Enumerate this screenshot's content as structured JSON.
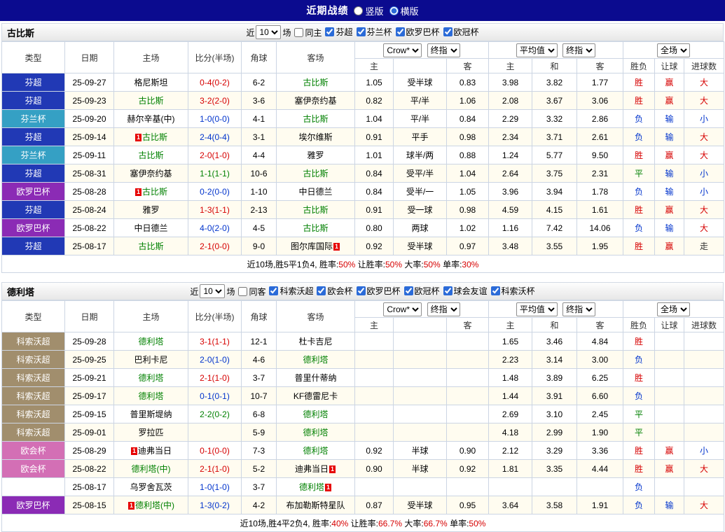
{
  "topbar": {
    "title": "近期战绩",
    "radio_vertical": "竖版",
    "radio_horizontal": "横版",
    "selected": "横版"
  },
  "colors": {
    "league": {
      "芬超": "#2139b5",
      "芬兰杯": "#35a0c4",
      "欧罗巴杯": "#8b2bb5",
      "科索沃超": "#a18e6d",
      "欧会杯": "#d36fb5"
    },
    "result": {
      "胜": "#d60000",
      "平": "#008000",
      "负": "#0033cc",
      "赢": "#d60000",
      "输": "#0033cc",
      "走": "#333333",
      "大": "#d60000",
      "小": "#0033cc"
    },
    "score": {
      "win": "#d60000",
      "draw": "#008000",
      "loss": "#0033cc"
    },
    "focal_team": "#008000",
    "summary_value": "#d60000"
  },
  "sections": [
    {
      "team": "古比斯",
      "filters": {
        "near": "近",
        "count": "10",
        "games": "场",
        "same": "同主",
        "same_checked": false,
        "leagues": [
          "芬超",
          "芬兰杯",
          "欧罗巴杯",
          "欧冠杯"
        ]
      },
      "head": {
        "type": "类型",
        "date": "日期",
        "home": "主场",
        "score": "比分(半场)",
        "corner": "角球",
        "away": "客场",
        "asia1": "Crow*",
        "asia2": "终指",
        "euro1": "平均值",
        "euro2": "终指",
        "scope": "全场",
        "h": "主",
        "a": "客",
        "d": "和",
        "res": "胜负",
        "let": "让球",
        "goal": "进球数"
      },
      "rows": [
        {
          "type": "芬超",
          "date": "25-09-27",
          "home": "格尼斯坦",
          "home_focal": false,
          "home_rc": "",
          "score": "0-4(0-2)",
          "outcome": "win",
          "corner": "6-2",
          "away": "古比斯",
          "away_focal": true,
          "away_rc": "",
          "ah": "1.05",
          "line": "受半球",
          "aa": "0.83",
          "eh": "3.98",
          "ed": "3.82",
          "ea": "1.77",
          "res": "胜",
          "let": "赢",
          "goal": "大"
        },
        {
          "type": "芬超",
          "date": "25-09-23",
          "home": "古比斯",
          "home_focal": true,
          "home_rc": "",
          "score": "3-2(2-0)",
          "outcome": "win",
          "corner": "3-6",
          "away": "塞伊奈约基",
          "away_focal": false,
          "away_rc": "",
          "ah": "0.82",
          "line": "平/半",
          "aa": "1.06",
          "eh": "2.08",
          "ed": "3.67",
          "ea": "3.06",
          "res": "胜",
          "let": "赢",
          "goal": "大"
        },
        {
          "type": "芬兰杯",
          "date": "25-09-20",
          "home": "赫尔辛基(中)",
          "home_focal": false,
          "home_rc": "",
          "score": "1-0(0-0)",
          "outcome": "loss",
          "corner": "4-1",
          "away": "古比斯",
          "away_focal": true,
          "away_rc": "",
          "ah": "1.04",
          "line": "平/半",
          "aa": "0.84",
          "eh": "2.29",
          "ed": "3.32",
          "ea": "2.86",
          "res": "负",
          "let": "输",
          "goal": "小"
        },
        {
          "type": "芬超",
          "date": "25-09-14",
          "home": "古比斯",
          "home_focal": true,
          "home_rc": "before",
          "score": "2-4(0-4)",
          "outcome": "loss",
          "corner": "3-1",
          "away": "埃尔维斯",
          "away_focal": false,
          "away_rc": "",
          "ah": "0.91",
          "line": "平手",
          "aa": "0.98",
          "eh": "2.34",
          "ed": "3.71",
          "ea": "2.61",
          "res": "负",
          "let": "输",
          "goal": "大"
        },
        {
          "type": "芬兰杯",
          "date": "25-09-11",
          "home": "古比斯",
          "home_focal": true,
          "home_rc": "",
          "score": "2-0(1-0)",
          "outcome": "win",
          "corner": "4-4",
          "away": "雅罗",
          "away_focal": false,
          "away_rc": "",
          "ah": "1.01",
          "line": "球半/两",
          "aa": "0.88",
          "eh": "1.24",
          "ed": "5.77",
          "ea": "9.50",
          "res": "胜",
          "let": "赢",
          "goal": "大"
        },
        {
          "type": "芬超",
          "date": "25-08-31",
          "home": "塞伊奈约基",
          "home_focal": false,
          "home_rc": "",
          "score": "1-1(1-1)",
          "outcome": "draw",
          "corner": "10-6",
          "away": "古比斯",
          "away_focal": true,
          "away_rc": "",
          "ah": "0.84",
          "line": "受平/半",
          "aa": "1.04",
          "eh": "2.64",
          "ed": "3.75",
          "ea": "2.31",
          "res": "平",
          "let": "输",
          "goal": "小"
        },
        {
          "type": "欧罗巴杯",
          "date": "25-08-28",
          "home": "古比斯",
          "home_focal": true,
          "home_rc": "before",
          "score": "0-2(0-0)",
          "outcome": "loss",
          "corner": "1-10",
          "away": "中日德兰",
          "away_focal": false,
          "away_rc": "",
          "ah": "0.84",
          "line": "受半/一",
          "aa": "1.05",
          "eh": "3.96",
          "ed": "3.94",
          "ea": "1.78",
          "res": "负",
          "let": "输",
          "goal": "小"
        },
        {
          "type": "芬超",
          "date": "25-08-24",
          "home": "雅罗",
          "home_focal": false,
          "home_rc": "",
          "score": "1-3(1-1)",
          "outcome": "win",
          "corner": "2-13",
          "away": "古比斯",
          "away_focal": true,
          "away_rc": "",
          "ah": "0.91",
          "line": "受一球",
          "aa": "0.98",
          "eh": "4.59",
          "ed": "4.15",
          "ea": "1.61",
          "res": "胜",
          "let": "赢",
          "goal": "大"
        },
        {
          "type": "欧罗巴杯",
          "date": "25-08-22",
          "home": "中日德兰",
          "home_focal": false,
          "home_rc": "",
          "score": "4-0(2-0)",
          "outcome": "loss",
          "corner": "4-5",
          "away": "古比斯",
          "away_focal": true,
          "away_rc": "",
          "ah": "0.80",
          "line": "两球",
          "aa": "1.02",
          "eh": "1.16",
          "ed": "7.42",
          "ea": "14.06",
          "res": "负",
          "let": "输",
          "goal": "大"
        },
        {
          "type": "芬超",
          "date": "25-08-17",
          "home": "古比斯",
          "home_focal": true,
          "home_rc": "",
          "score": "2-1(0-0)",
          "outcome": "win",
          "corner": "9-0",
          "away": "图尔库国际",
          "away_focal": false,
          "away_rc": "after",
          "ah": "0.92",
          "line": "受半球",
          "aa": "0.97",
          "eh": "3.48",
          "ed": "3.55",
          "ea": "1.95",
          "res": "胜",
          "let": "赢",
          "goal": "走"
        }
      ],
      "summary_prefix": "近10场,胜5平1负4,",
      "summary": [
        {
          "k": " 胜率:",
          "v": "50%"
        },
        {
          "k": " 让胜率:",
          "v": "50%"
        },
        {
          "k": " 大率:",
          "v": "50%"
        },
        {
          "k": " 单率:",
          "v": "30%"
        }
      ]
    },
    {
      "team": "德利塔",
      "filters": {
        "near": "近",
        "count": "10",
        "games": "场",
        "same": "同客",
        "same_checked": false,
        "leagues": [
          "科索沃超",
          "欧会杯",
          "欧罗巴杯",
          "欧冠杯",
          "球会友谊",
          "科索沃杯"
        ]
      },
      "head": {
        "type": "类型",
        "date": "日期",
        "home": "主场",
        "score": "比分(半场)",
        "corner": "角球",
        "away": "客场",
        "asia1": "Crow*",
        "asia2": "终指",
        "euro1": "平均值",
        "euro2": "终指",
        "scope": "全场",
        "h": "主",
        "a": "客",
        "d": "和",
        "res": "胜负",
        "let": "让球",
        "goal": "进球数"
      },
      "rows": [
        {
          "type": "科索沃超",
          "date": "25-09-28",
          "home": "德利塔",
          "home_focal": true,
          "home_rc": "",
          "score": "3-1(1-1)",
          "outcome": "win",
          "corner": "12-1",
          "away": "杜卡吉尼",
          "away_focal": false,
          "away_rc": "",
          "ah": "",
          "line": "",
          "aa": "",
          "eh": "1.65",
          "ed": "3.46",
          "ea": "4.84",
          "res": "胜",
          "let": "",
          "goal": ""
        },
        {
          "type": "科索沃超",
          "date": "25-09-25",
          "home": "巴利卡尼",
          "home_focal": false,
          "home_rc": "",
          "score": "2-0(1-0)",
          "outcome": "loss",
          "corner": "4-6",
          "away": "德利塔",
          "away_focal": true,
          "away_rc": "",
          "ah": "",
          "line": "",
          "aa": "",
          "eh": "2.23",
          "ed": "3.14",
          "ea": "3.00",
          "res": "负",
          "let": "",
          "goal": ""
        },
        {
          "type": "科索沃超",
          "date": "25-09-21",
          "home": "德利塔",
          "home_focal": true,
          "home_rc": "",
          "score": "2-1(1-0)",
          "outcome": "win",
          "corner": "3-7",
          "away": "普里什蒂纳",
          "away_focal": false,
          "away_rc": "",
          "ah": "",
          "line": "",
          "aa": "",
          "eh": "1.48",
          "ed": "3.89",
          "ea": "6.25",
          "res": "胜",
          "let": "",
          "goal": ""
        },
        {
          "type": "科索沃超",
          "date": "25-09-17",
          "home": "德利塔",
          "home_focal": true,
          "home_rc": "",
          "score": "0-1(0-1)",
          "outcome": "loss",
          "corner": "10-7",
          "away": "KF德雷尼卡",
          "away_focal": false,
          "away_rc": "",
          "ah": "",
          "line": "",
          "aa": "",
          "eh": "1.44",
          "ed": "3.91",
          "ea": "6.60",
          "res": "负",
          "let": "",
          "goal": ""
        },
        {
          "type": "科索沃超",
          "date": "25-09-15",
          "home": "普里斯堤纳",
          "home_focal": false,
          "home_rc": "",
          "score": "2-2(0-2)",
          "outcome": "draw",
          "corner": "6-8",
          "away": "德利塔",
          "away_focal": true,
          "away_rc": "",
          "ah": "",
          "line": "",
          "aa": "",
          "eh": "2.69",
          "ed": "3.10",
          "ea": "2.45",
          "res": "平",
          "let": "",
          "goal": ""
        },
        {
          "type": "科索沃超",
          "date": "25-09-01",
          "home": "罗拉匹",
          "home_focal": false,
          "home_rc": "",
          "score": "",
          "outcome": "",
          "corner": "5-9",
          "away": "德利塔",
          "away_focal": true,
          "away_rc": "",
          "ah": "",
          "line": "",
          "aa": "",
          "eh": "4.18",
          "ed": "2.99",
          "ea": "1.90",
          "res": "平",
          "let": "",
          "goal": ""
        },
        {
          "type": "欧会杯",
          "date": "25-08-29",
          "home": "迪弗当日",
          "home_focal": false,
          "home_rc": "before",
          "score": "0-1(0-0)",
          "outcome": "win",
          "corner": "7-3",
          "away": "德利塔",
          "away_focal": true,
          "away_rc": "",
          "ah": "0.92",
          "line": "半球",
          "aa": "0.90",
          "eh": "2.12",
          "ed": "3.29",
          "ea": "3.36",
          "res": "胜",
          "let": "赢",
          "goal": "小"
        },
        {
          "type": "欧会杯",
          "date": "25-08-22",
          "home": "德利塔(中)",
          "home_focal": true,
          "home_rc": "",
          "score": "2-1(1-0)",
          "outcome": "win",
          "corner": "5-2",
          "away": "迪弗当日",
          "away_focal": false,
          "away_rc": "after",
          "ah": "0.90",
          "line": "半球",
          "aa": "0.92",
          "eh": "1.81",
          "ed": "3.35",
          "ea": "4.44",
          "res": "胜",
          "let": "赢",
          "goal": "大"
        },
        {
          "type": "",
          "date": "25-08-17",
          "home": "乌罗舍瓦茨",
          "home_focal": false,
          "home_rc": "",
          "score": "1-0(1-0)",
          "outcome": "loss",
          "corner": "3-7",
          "away": "德利塔",
          "away_focal": true,
          "away_rc": "after",
          "ah": "",
          "line": "",
          "aa": "",
          "eh": "",
          "ed": "",
          "ea": "",
          "res": "负",
          "let": "",
          "goal": ""
        },
        {
          "type": "欧罗巴杯",
          "date": "25-08-15",
          "home": "德利塔(中)",
          "home_focal": true,
          "home_rc": "before",
          "score": "1-3(0-2)",
          "outcome": "loss",
          "corner": "4-2",
          "away": "布加勒斯特星队",
          "away_focal": false,
          "away_rc": "",
          "ah": "0.87",
          "line": "受半球",
          "aa": "0.95",
          "eh": "3.64",
          "ed": "3.58",
          "ea": "1.91",
          "res": "负",
          "let": "输",
          "goal": "大"
        }
      ],
      "summary_prefix": "近10场,胜4平2负4,",
      "summary": [
        {
          "k": " 胜率:",
          "v": "40%"
        },
        {
          "k": " 让胜率:",
          "v": "66.7%"
        },
        {
          "k": " 大率:",
          "v": "66.7%"
        },
        {
          "k": " 单率:",
          "v": "50%"
        }
      ]
    }
  ]
}
